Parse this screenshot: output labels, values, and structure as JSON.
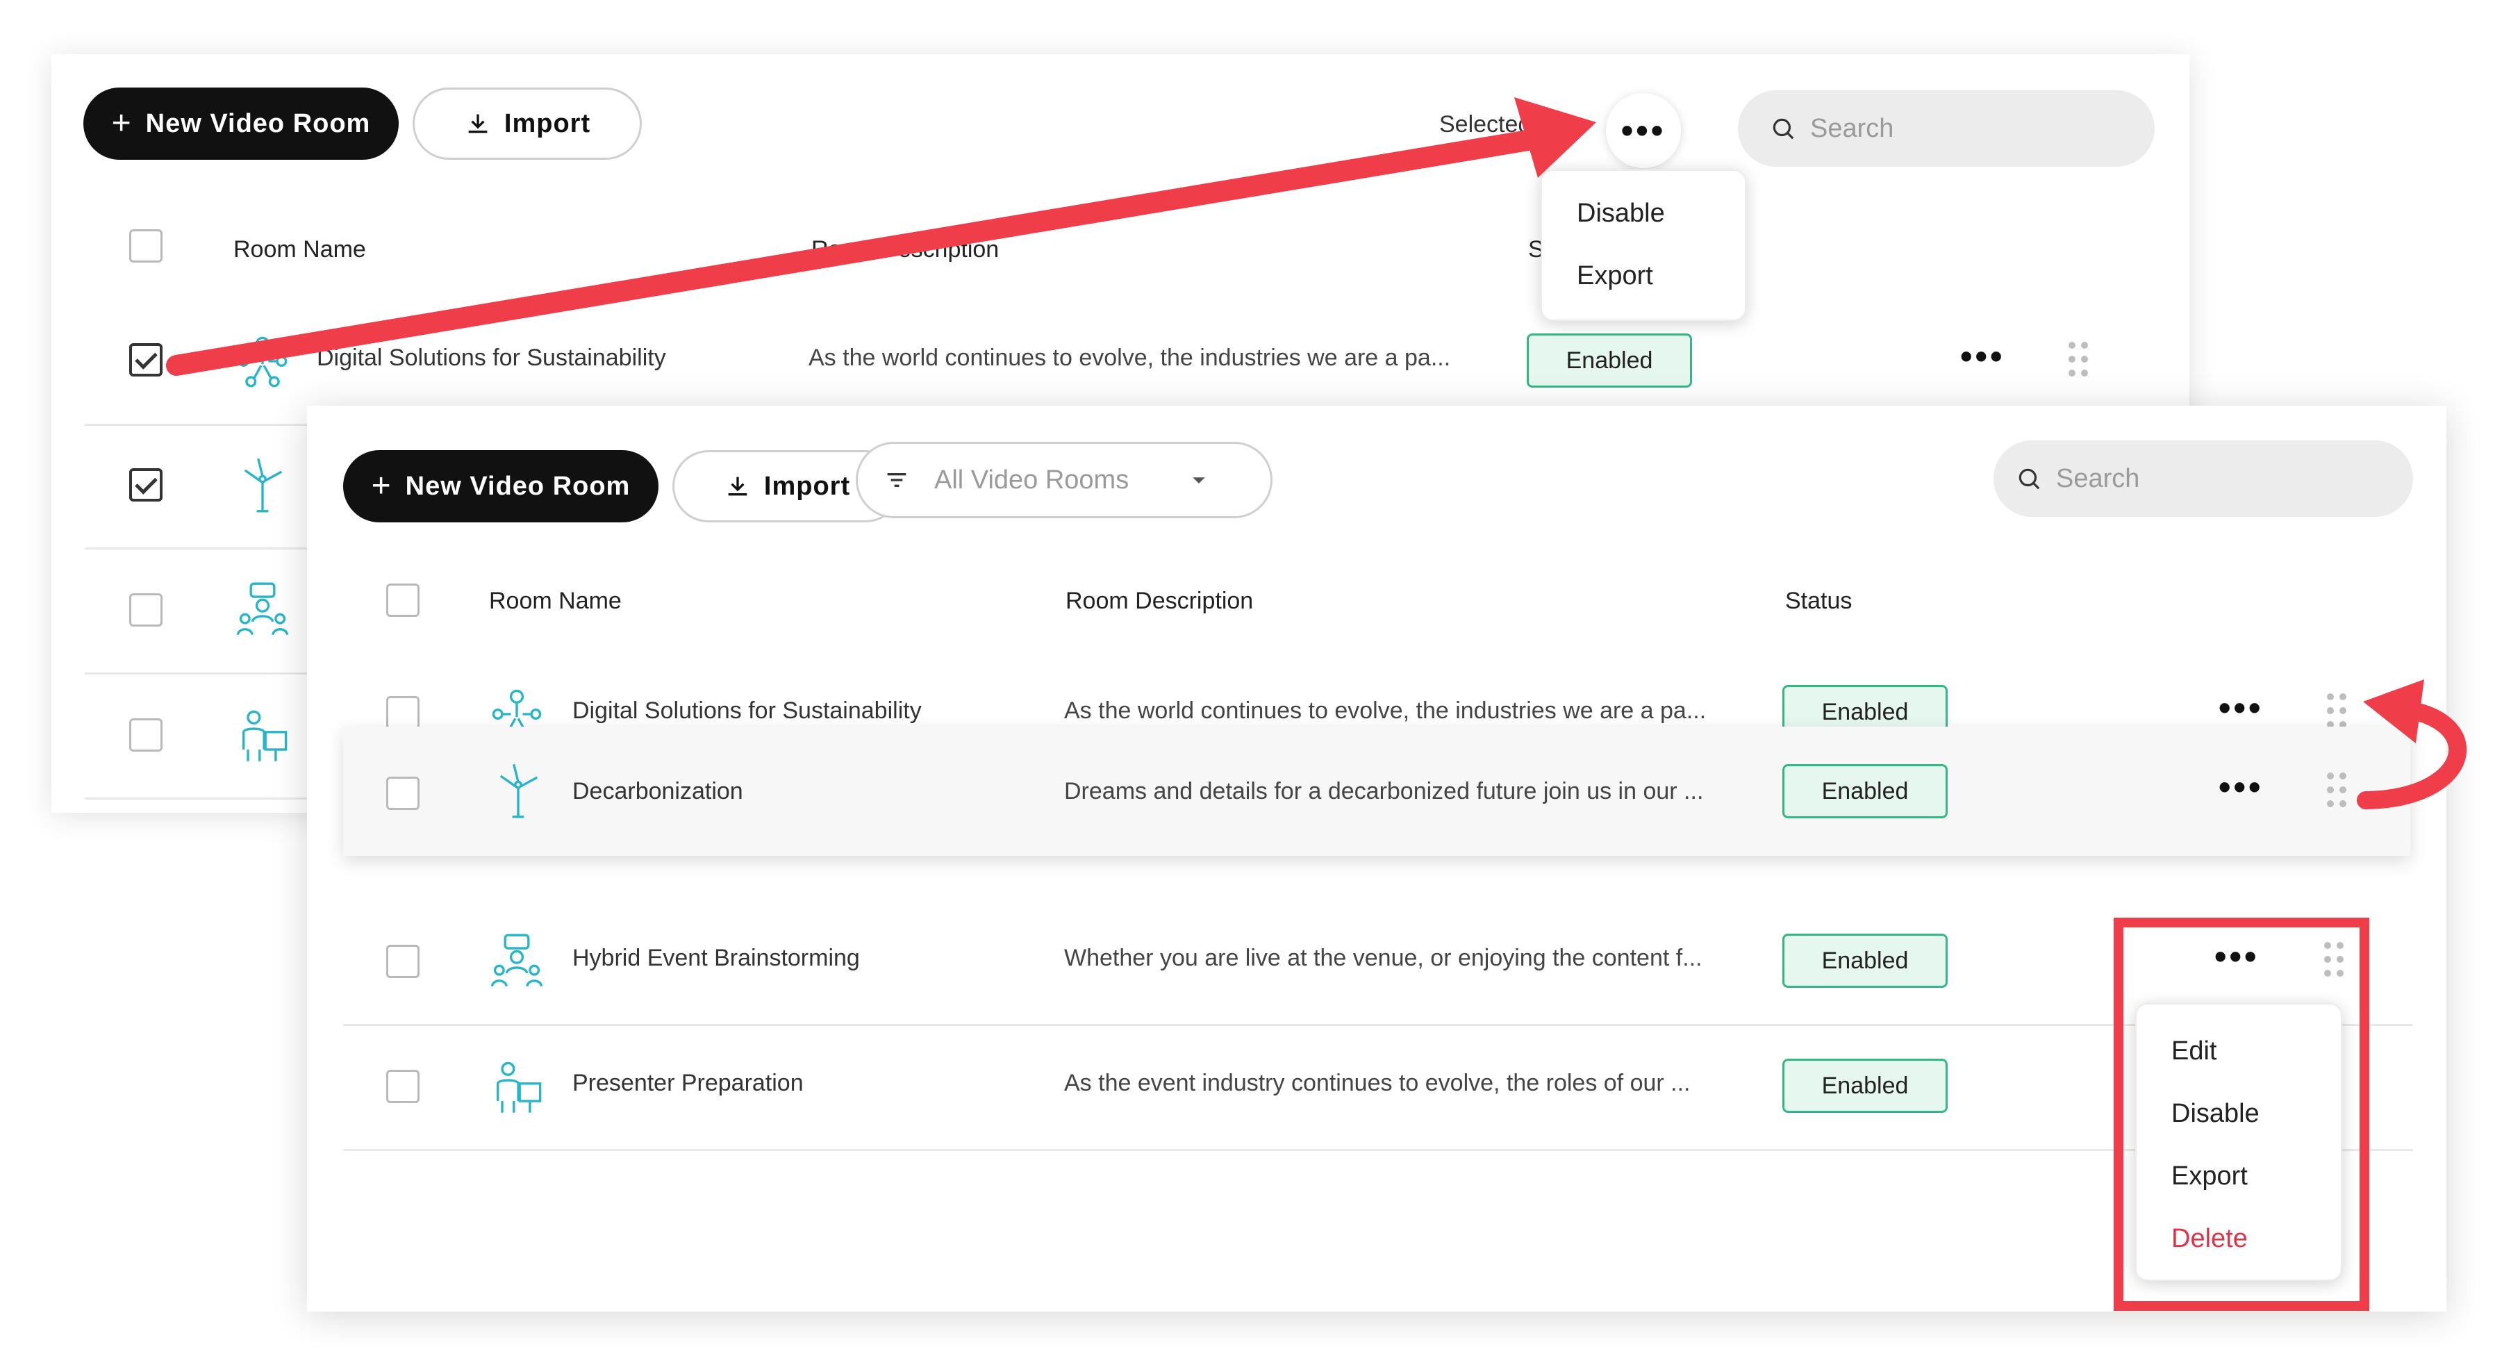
{
  "back_panel": {
    "new_room_label": "New Video Room",
    "import_label": "Import",
    "selected_label": "Selected",
    "search_placeholder": "Search",
    "more_icon": "more-horizontal-icon",
    "menu": [
      "Disable",
      "Export"
    ],
    "columns": {
      "name": "Room Name",
      "description": "Room Description",
      "status": "S"
    },
    "rows": [
      {
        "name": "Digital Solutions for Sustainability",
        "description": "As the world continues to evolve, the industries we are a pa...",
        "status": "Enabled",
        "checked": true
      },
      {
        "checked": true
      },
      {
        "checked": false
      },
      {
        "checked": false
      }
    ]
  },
  "front_panel": {
    "new_room_label": "New Video Room",
    "import_label": "Import",
    "filter_label": "All Video Rooms",
    "search_placeholder": "Search",
    "columns": {
      "name": "Room Name",
      "description": "Room Description",
      "status": "Status"
    },
    "rows": [
      {
        "name": "Digital Solutions for Sustainability",
        "description": "As the world continues to evolve, the industries we are a pa...",
        "status": "Enabled",
        "icon": "network-icon"
      },
      {
        "name": "Decarbonization",
        "description": "Dreams and details for a decarbonized future join us in our ...",
        "status": "Enabled",
        "icon": "wind-turbine-icon"
      },
      {
        "name": "Hybrid Event Brainstorming",
        "description": "Whether you are live at the venue, or enjoying the content f...",
        "status": "Enabled",
        "icon": "group-discussion-icon"
      },
      {
        "name": "Presenter Preparation",
        "description": "As the event industry continues to evolve, the roles of our ...",
        "status": "Enabled",
        "icon": "presenter-icon"
      }
    ],
    "row_menu": [
      {
        "label": "Edit"
      },
      {
        "label": "Disable"
      },
      {
        "label": "Export"
      },
      {
        "label": "Delete",
        "danger": true
      }
    ]
  },
  "colors": {
    "primary_button": "#111111",
    "status_border": "#34b888",
    "status_fill": "#e6f7ef",
    "icon_teal": "#27b5c9",
    "annotation_red": "#ef3e4a",
    "danger_text": "#e13348"
  }
}
